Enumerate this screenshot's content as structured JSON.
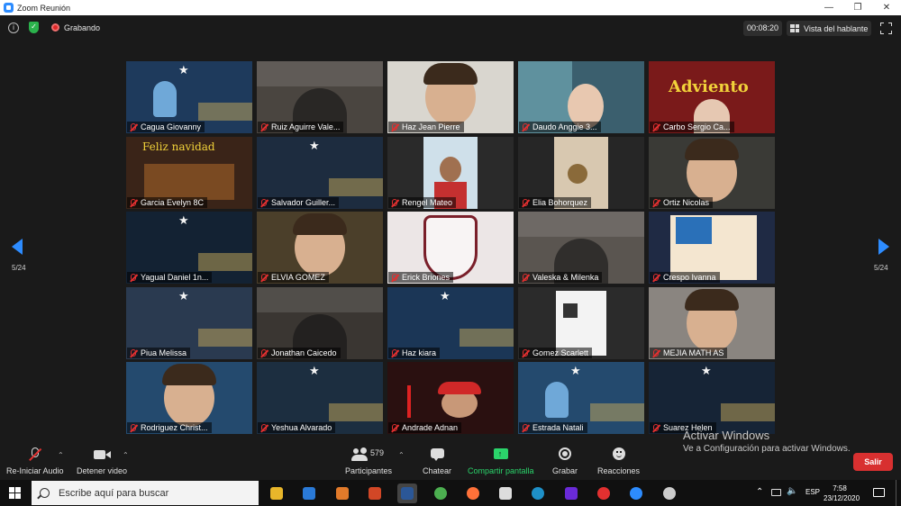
{
  "window": {
    "title": "Zoom Reunión"
  },
  "topbar": {
    "recording_label": "Grabando",
    "timer": "00:08:20",
    "view_label": "Vista del hablante"
  },
  "navigation": {
    "page_left": "5/24",
    "page_right": "5/24"
  },
  "participants": [
    {
      "name": "Cagua Giovanny",
      "bg": "#1e3a5c"
    },
    {
      "name": "Ruiz Aguirre Vale...",
      "bg": "#4a4540"
    },
    {
      "name": "Haz Jean Pierre",
      "bg": "#d9d6cf"
    },
    {
      "name": "Daudo Anggie  3...",
      "bg": "#3b5f6e"
    },
    {
      "name": "Carbo Sergio Ca...",
      "bg": "#7a1a1a"
    },
    {
      "name": "Garcia Evelyn 8C",
      "bg": "#3a2418"
    },
    {
      "name": "Salvador Guiller...",
      "bg": "#1d2c3f"
    },
    {
      "name": "Rengel Mateo",
      "bg": "#2a2a2a"
    },
    {
      "name": "Elia Bohorquez",
      "bg": "#262626"
    },
    {
      "name": "Ortiz Nicolas",
      "bg": "#3a3a36"
    },
    {
      "name": "Yagual Daniel  1n...",
      "bg": "#132233"
    },
    {
      "name": "ELVIA GOMEZ",
      "bg": "#4b3f2a"
    },
    {
      "name": "Erick Briones",
      "bg": "#ece6e6"
    },
    {
      "name": "Valeska & Milenka",
      "bg": "#5a5550"
    },
    {
      "name": "Crespo Ivanna",
      "bg": "#1f2a44"
    },
    {
      "name": "Piua Melissa",
      "bg": "#2a3a50"
    },
    {
      "name": "Jonathan Caicedo",
      "bg": "#3a3632"
    },
    {
      "name": "Haz kiara",
      "bg": "#1b3656"
    },
    {
      "name": "Gomez Scarlett",
      "bg": "#2b2b2b"
    },
    {
      "name": "MEJIA MATH AS",
      "bg": "#8a8580"
    },
    {
      "name": "Rodriguez Christ...",
      "bg": "#244a6e"
    },
    {
      "name": "Yeshua Alvarado",
      "bg": "#1c2e40"
    },
    {
      "name": "Andrade Adnan",
      "bg": "#2a1010"
    },
    {
      "name": "Estrada Natali",
      "bg": "#244a6e"
    },
    {
      "name": "Suarez Helen",
      "bg": "#162436"
    }
  ],
  "tile_text": {
    "christmas_green": "Feliz Navidad",
    "christmas_ha": "Feliz Navidad",
    "adviento": "Adviento",
    "feliz_navidad_low": "Feliz navidad"
  },
  "toolbar": {
    "audio_label": "Re-Iniciar Audio",
    "video_label": "Detener video",
    "participants_label": "Participantes",
    "participants_count": "579",
    "chat_label": "Chatear",
    "share_label": "Compartir pantalla",
    "record_label": "Grabar",
    "reactions_label": "Reacciones",
    "leave_label": "Salir"
  },
  "watermark": {
    "line1": "Activar Windows",
    "line2": "Ve a Configuración para activar Windows."
  },
  "taskbar": {
    "search_placeholder": "Escribe aquí para buscar",
    "language": "ESP",
    "time": "7:58",
    "date": "23/12/2020"
  },
  "colors": {
    "zoom_blue": "#2d8cff",
    "share_green": "#2bd46b",
    "leave_red": "#d83030",
    "mic_red": "#e23030"
  }
}
